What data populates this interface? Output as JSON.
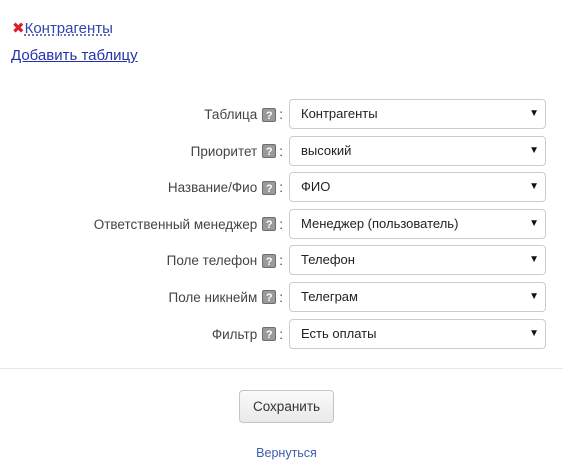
{
  "header": {
    "delete_icon": "close-icon",
    "title_link": "Контрагенты",
    "add_table_link": "Добавить таблицу"
  },
  "form": {
    "rows": [
      {
        "label": "Таблица",
        "value": "Контрагенты"
      },
      {
        "label": "Приоритет",
        "value": "высокий"
      },
      {
        "label": "Название/Фио",
        "value": "ФИО"
      },
      {
        "label": "Ответственный менеджер",
        "value": "Менеджер (пользователь)"
      },
      {
        "label": "Поле телефон",
        "value": "Телефон"
      },
      {
        "label": "Поле никнейм",
        "value": "Телеграм"
      },
      {
        "label": "Фильтр",
        "value": "Есть оплаты"
      }
    ],
    "help_glyph": "?",
    "colon": ":",
    "caret_glyph": "▼"
  },
  "footer": {
    "save_label": "Сохранить",
    "back_label": "Вернуться"
  },
  "colors": {
    "link": "#3344aa",
    "delete_icon": "#d9202a",
    "back_link": "#3a5fb0"
  }
}
